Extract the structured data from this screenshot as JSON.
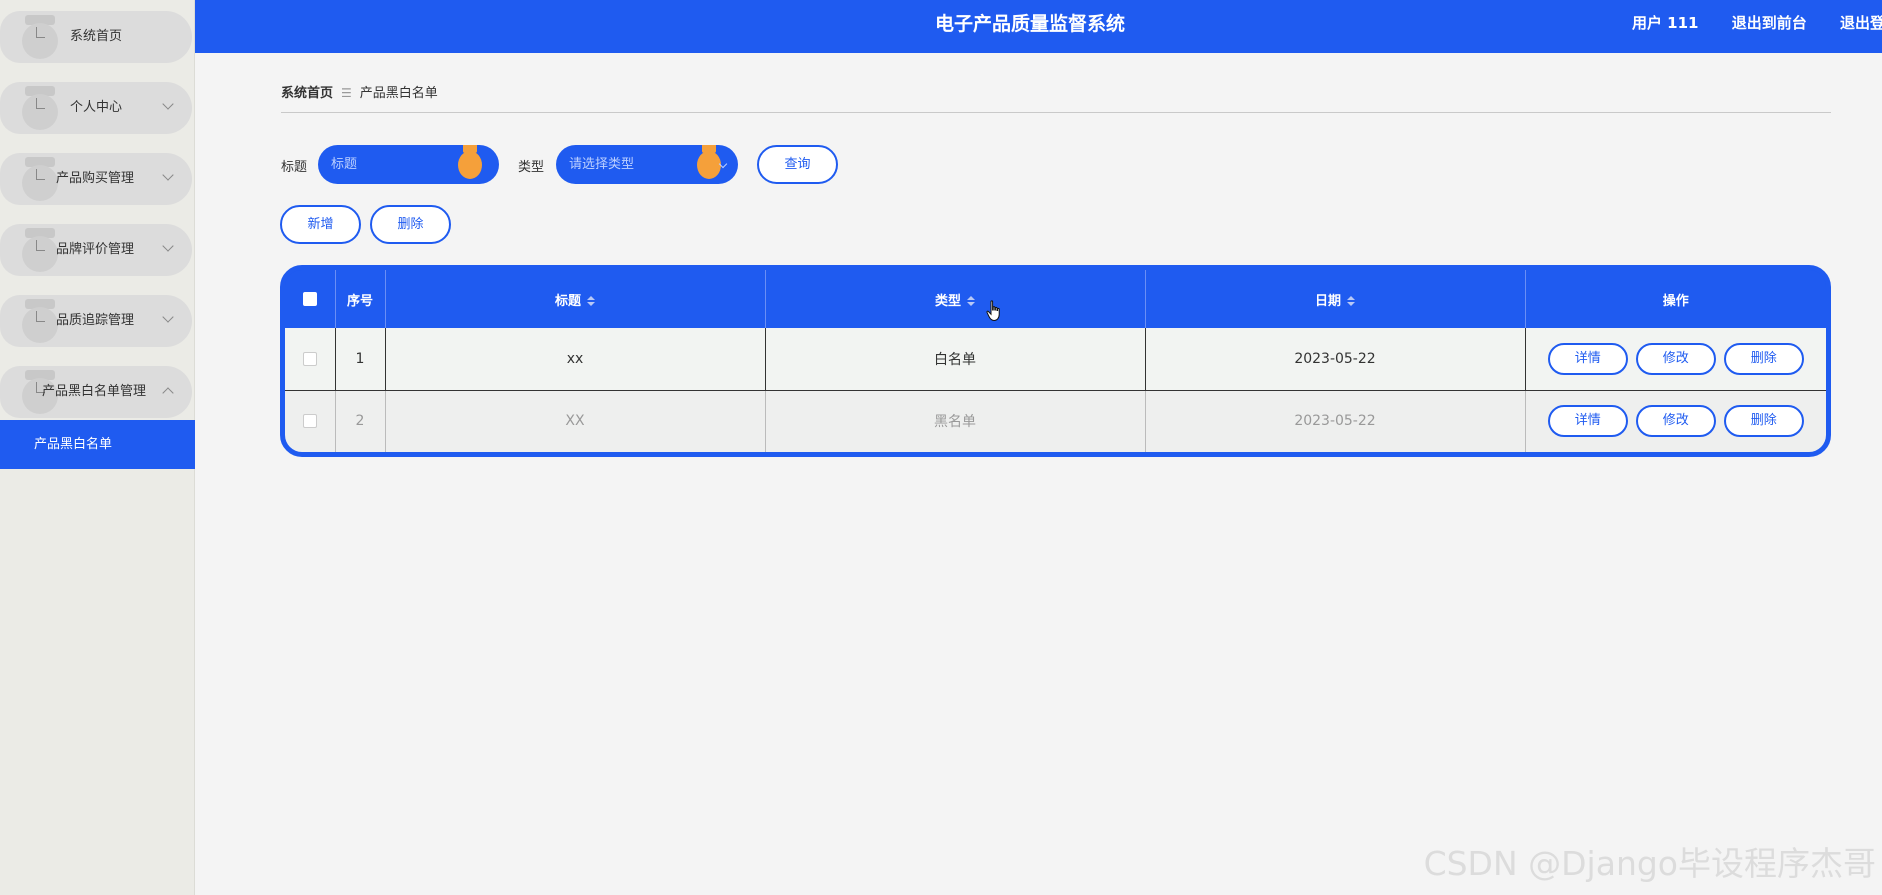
{
  "header": {
    "title": "电子产品质量监督系统",
    "user": "用户 111",
    "back_front": "退出到前台",
    "logout": "退出登录"
  },
  "sidebar": {
    "items": [
      {
        "label": "系统首页"
      },
      {
        "label": "个人中心"
      },
      {
        "label": "产品购买管理"
      },
      {
        "label": "品牌评价管理"
      },
      {
        "label": "品质追踪管理"
      },
      {
        "label": "产品黑白名单管理"
      }
    ],
    "active_sub": "产品黑白名单"
  },
  "breadcrumb": {
    "home": "系统首页",
    "current": "产品黑白名单"
  },
  "search": {
    "title_label": "标题",
    "title_placeholder": "标题",
    "type_label": "类型",
    "type_placeholder": "请选择类型",
    "query_button": "查询"
  },
  "actions": {
    "add": "新增",
    "delete": "删除"
  },
  "table": {
    "headers": {
      "index": "序号",
      "title": "标题",
      "type": "类型",
      "date": "日期",
      "ops": "操作"
    },
    "rows": [
      {
        "index": "1",
        "title": "xx",
        "type": "白名单",
        "date": "2023-05-22"
      },
      {
        "index": "2",
        "title": "XX",
        "type": "黑名单",
        "date": "2023-05-22"
      }
    ],
    "ops": {
      "detail": "详情",
      "edit": "修改",
      "delete": "删除"
    }
  },
  "watermark": "CSDN @Django毕设程序杰哥",
  "colors": {
    "primary": "#1f5bf0",
    "accent": "#f5a03a"
  }
}
